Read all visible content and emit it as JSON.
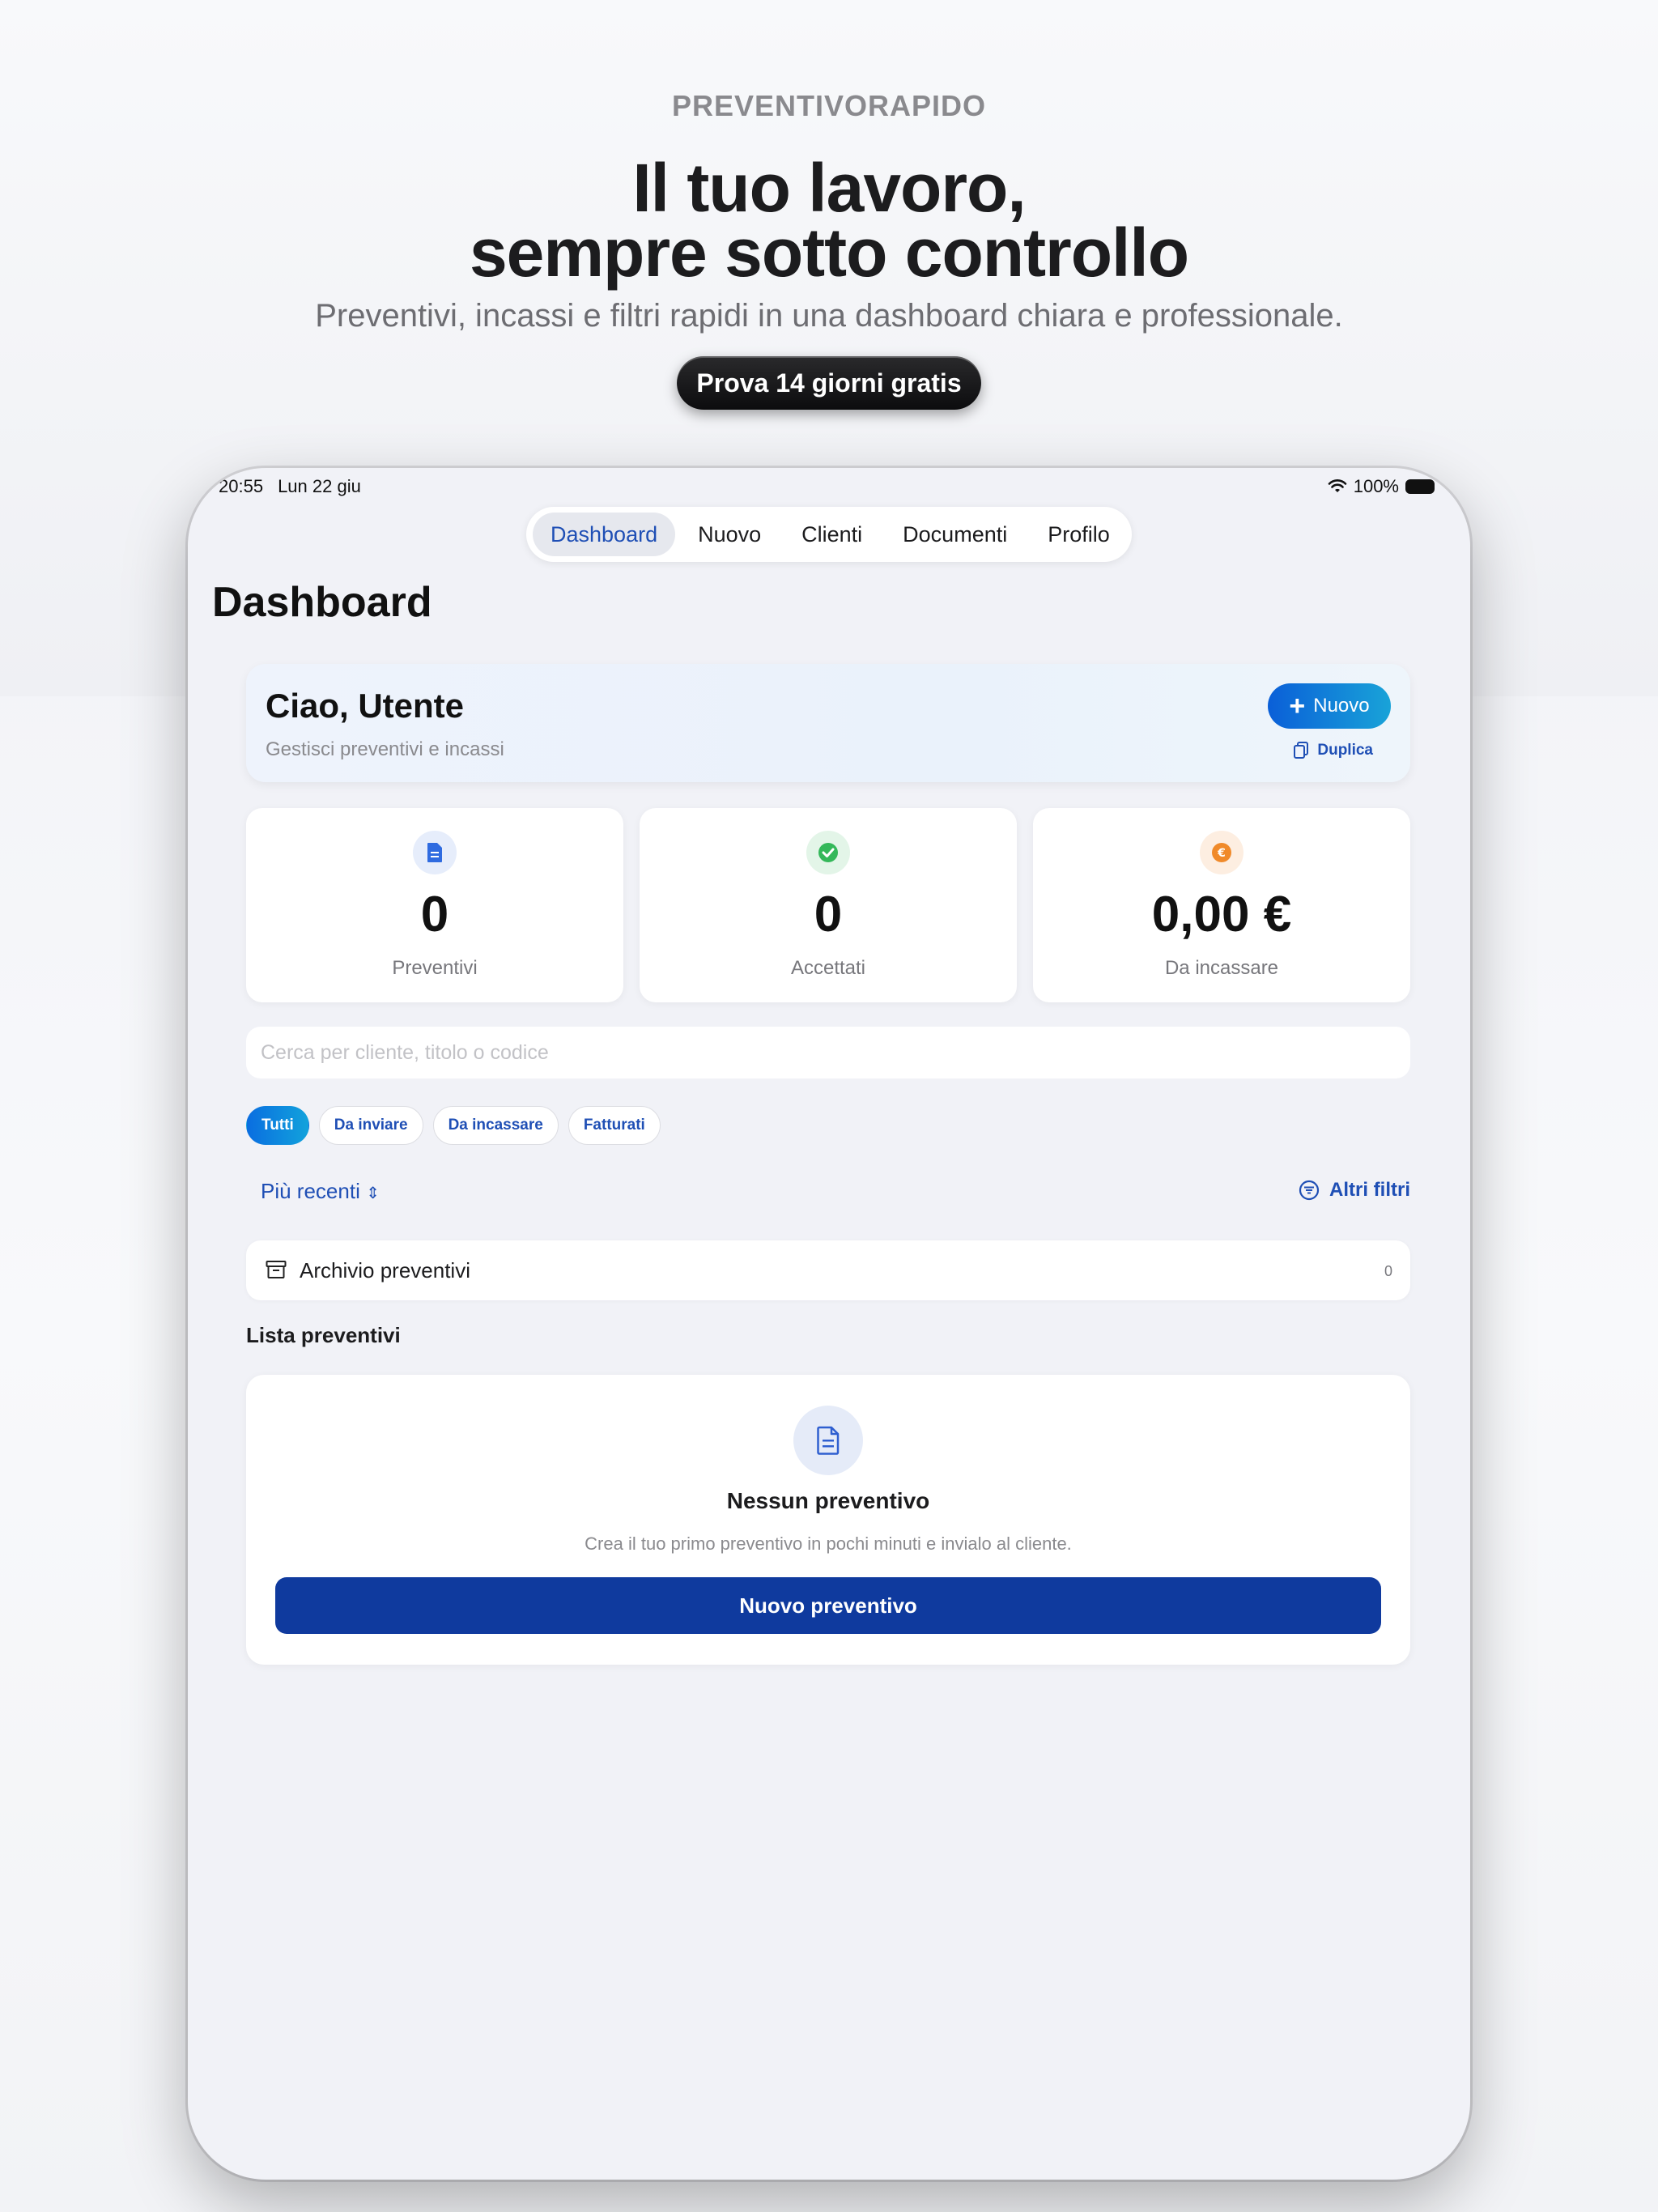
{
  "promo": {
    "brand": "PREVENTIVORAPIDO",
    "headline_line1": "Il tuo lavoro,",
    "headline_line2": "sempre sotto controllo",
    "subheadline": "Preventivi, incassi e filtri rapidi in una dashboard chiara e professionale.",
    "cta": "Prova 14 giorni gratis"
  },
  "status_bar": {
    "time": "20:55",
    "date": "Lun 22 giu",
    "battery": "100%",
    "icons": [
      "wifi-icon",
      "battery-icon"
    ]
  },
  "nav": {
    "tabs": [
      {
        "label": "Dashboard",
        "active": true
      },
      {
        "label": "Nuovo",
        "active": false
      },
      {
        "label": "Clienti",
        "active": false
      },
      {
        "label": "Documenti",
        "active": false
      },
      {
        "label": "Profilo",
        "active": false
      }
    ]
  },
  "page": {
    "title": "Dashboard"
  },
  "greeting": {
    "title": "Ciao, Utente",
    "subtitle": "Gestisci preventivi e incassi",
    "new_button": "Nuovo",
    "duplicate_button": "Duplica"
  },
  "stats": [
    {
      "value": "0",
      "label": "Preventivi",
      "icon": "document-icon",
      "color": "#2f6be0",
      "bg": "#e6edfb"
    },
    {
      "value": "0",
      "label": "Accettati",
      "icon": "check-badge-icon",
      "color": "#34b85a",
      "bg": "#e3f5e8"
    },
    {
      "value": "0,00 €",
      "label": "Da incassare",
      "icon": "euro-coin-icon",
      "color": "#f08a2a",
      "bg": "#fdeee1"
    }
  ],
  "search": {
    "placeholder": "Cerca per cliente, titolo o codice"
  },
  "filters": {
    "chips": [
      {
        "label": "Tutti",
        "active": true
      },
      {
        "label": "Da inviare",
        "active": false
      },
      {
        "label": "Da incassare",
        "active": false
      },
      {
        "label": "Fatturati",
        "active": false
      }
    ],
    "sort_label": "Più recenti",
    "more_filters": "Altri filtri"
  },
  "archive": {
    "label": "Archivio preventivi",
    "count": "0"
  },
  "list": {
    "title": "Lista preventivi",
    "empty_title": "Nessun preventivo",
    "empty_subtitle": "Crea il tuo primo preventivo in pochi minuti e invialo al cliente.",
    "empty_button": "Nuovo preventivo"
  },
  "colors": {
    "accent": "#1f4fb5",
    "primary_button": "#0f3a9e",
    "background": "#f1f2f7"
  }
}
